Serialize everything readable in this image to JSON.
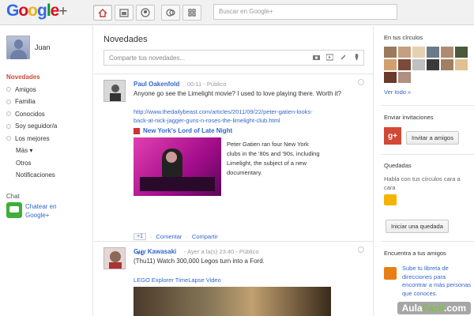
{
  "brand": {
    "logo_g": "G",
    "logo_o1": "o",
    "logo_o2": "o",
    "logo_g2": "g",
    "logo_l": "l",
    "logo_e": "e",
    "logo_plus": "+"
  },
  "nav": {
    "buttons": [
      "home-icon",
      "photos-icon",
      "profile-icon",
      "circles-icon",
      "games-icon"
    ]
  },
  "search": {
    "placeholder": "Buscar en Google+"
  },
  "user": {
    "name": "Juan"
  },
  "streams": {
    "items": [
      "Novedades",
      "Amigos",
      "Familia",
      "Conocidos",
      "Soy seguidor/a",
      "Los mejores",
      "Más ▾",
      "Otros",
      "Notificaciones"
    ]
  },
  "chat": {
    "title": "Chat",
    "link": "Chatear en Google+"
  },
  "main": {
    "title": "Novedades",
    "share_placeholder": "Comparte tus novedades..."
  },
  "post1": {
    "author": "Paul Oakenfold",
    "time": "00:11",
    "sep": "-",
    "visibility": "Público",
    "text": "Anyone go see the Limelight movie? I used to love playing there. Worth it?",
    "link": "http://www.thedailybeast.com/articles/2011/09/22/peter-gatien-looks-back-at-nick-jagger-guns-n-roses-the-limelight-club.html",
    "attachment_title": "New York's Lord of Late Night",
    "attachment_desc": "Peter Gatien ran four New York clubs in the '80s and '90s, including Limelight, the subject of a new documentary.",
    "plus1": "+1",
    "comment": "Comentar",
    "share": "Compartir",
    "plus_count": "+1"
  },
  "post2": {
    "author": "Guy Kawasaki",
    "time": "Ayer a la(s) 23:40",
    "sep": "-",
    "visibility": "Público",
    "text": "(Thu11) Watch 300,000 Legos turn into a Ford.",
    "link": "LEGO Explorer TimeLapse Video"
  },
  "right": {
    "circles_title": "En tus círculos",
    "see_all": "Ver todo »",
    "invite_title": "Enviar invitaciones",
    "invite_button": "Invitar a amigos",
    "hangout_title": "Quedadas",
    "hangout_text": "Habla con tus círculos cara a cara",
    "hangout_button": "Iniciar una quedada",
    "find_title": "Encuentra a tus amigos",
    "find_text": "Sube tu libreta de direcciones para encontrar a más personas que conoces."
  },
  "watermark": {
    "aula": "Aula",
    "facil": "Facil",
    "com": ".com"
  },
  "colors": {
    "accent_red": "#d14836",
    "link_blue": "#3366cc",
    "chat_green": "#3fae39"
  }
}
